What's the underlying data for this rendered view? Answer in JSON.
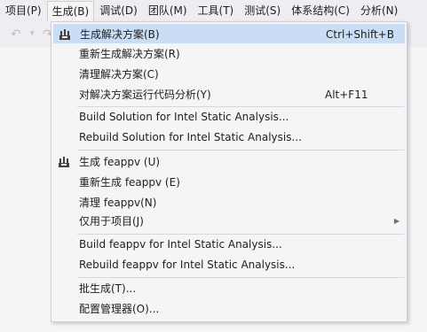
{
  "menubar": {
    "items": [
      "项目(P)",
      "生成(B)",
      "调试(D)",
      "团队(M)",
      "工具(T)",
      "测试(S)",
      "体系结构(C)",
      "分析(N)"
    ]
  },
  "toolbar": {
    "undo_icon": "undo-icon",
    "redo_icon": "redo-icon"
  },
  "build_menu": {
    "items": [
      {
        "label": "生成解决方案(B)",
        "shortcut": "Ctrl+Shift+B",
        "icon": "build-solution-icon"
      },
      {
        "label": "重新生成解决方案(R)"
      },
      {
        "label": "清理解决方案(C)"
      },
      {
        "label": "对解决方案运行代码分析(Y)",
        "shortcut": "Alt+F11"
      },
      {
        "label": "Build Solution for Intel Static Analysis..."
      },
      {
        "label": "Rebuild Solution for Intel Static Analysis..."
      },
      {
        "label": "生成 feappv (U)",
        "icon": "build-project-icon"
      },
      {
        "label": "重新生成 feappv (E)"
      },
      {
        "label": "清理 feappv(N)"
      },
      {
        "label": "仅用于项目(J)",
        "has_submenu": true
      },
      {
        "label": "Build feappv for Intel Static Analysis..."
      },
      {
        "label": "Rebuild feappv for Intel Static Analysis..."
      },
      {
        "label": "批生成(T)..."
      },
      {
        "label": "配置管理器(O)..."
      }
    ]
  },
  "colors": {
    "highlight": "#c9def5",
    "menu_bg": "#f5f5f5",
    "chrome_bg": "#eeeef2"
  }
}
